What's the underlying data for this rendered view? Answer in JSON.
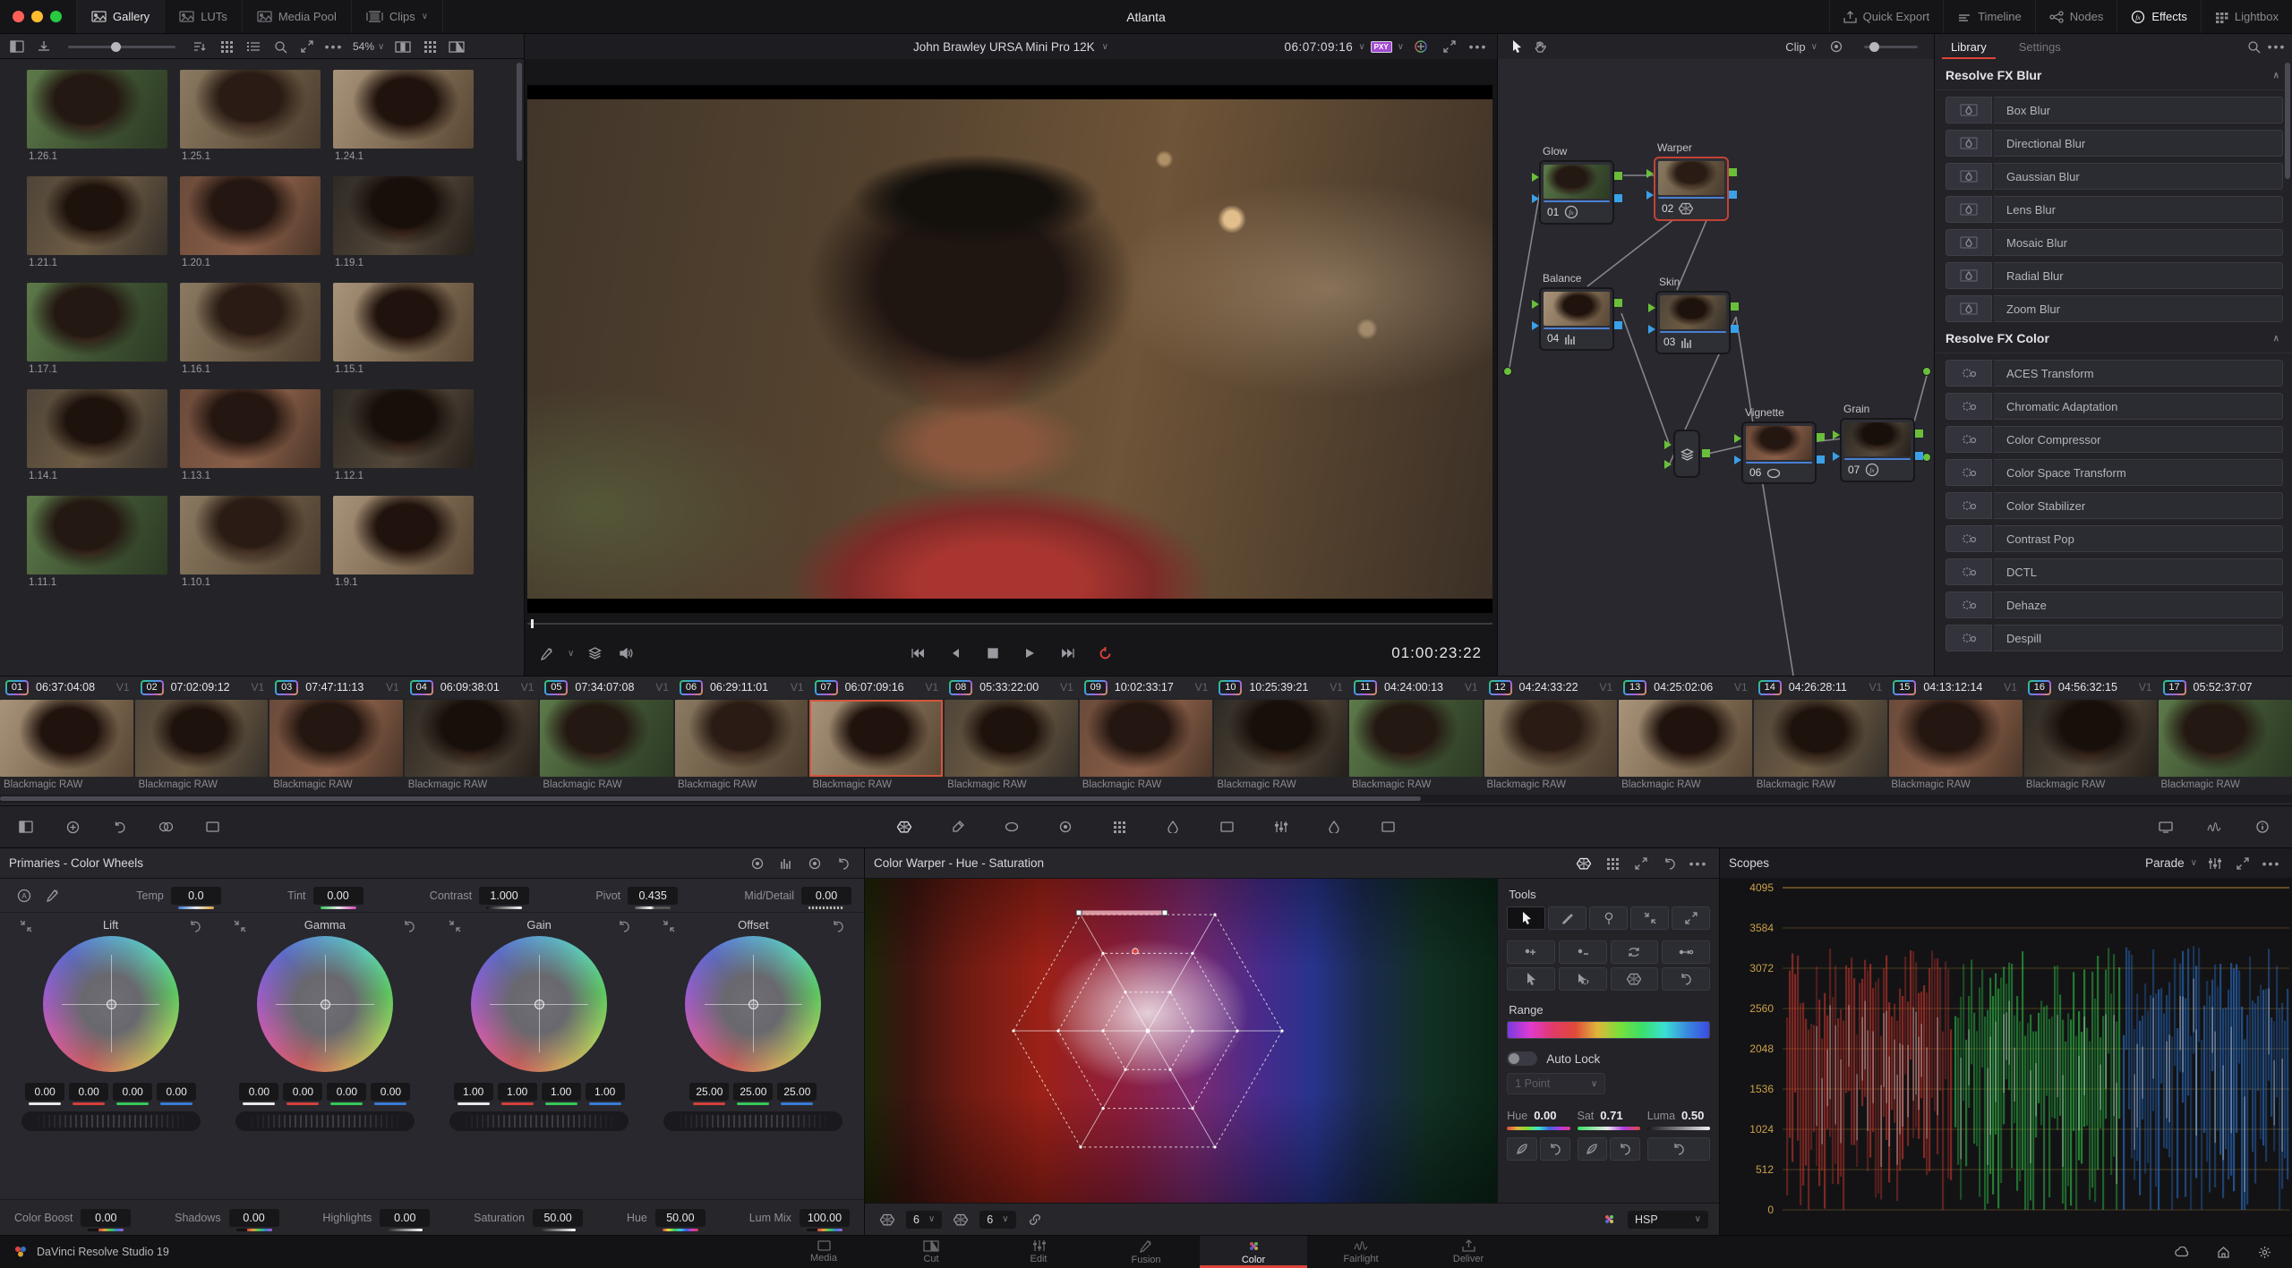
{
  "app": {
    "title": "Atlanta",
    "brand": "DaVinci Resolve Studio 19"
  },
  "topbar": {
    "left_tabs": [
      {
        "label": "Gallery",
        "icon": "gallery-icon",
        "active": true
      },
      {
        "label": "LUTs",
        "icon": "luts-icon",
        "active": false
      },
      {
        "label": "Media Pool",
        "icon": "media-pool-icon",
        "active": false
      },
      {
        "label": "Clips",
        "icon": "clips-icon",
        "active": false,
        "dropdown": true
      }
    ],
    "right_buttons": [
      {
        "label": "Quick Export",
        "icon": "export-icon",
        "active": false
      },
      {
        "label": "Timeline",
        "icon": "timeline-icon",
        "active": false
      },
      {
        "label": "Nodes",
        "icon": "nodes-icon",
        "active": false
      },
      {
        "label": "Effects",
        "icon": "effects-icon",
        "active": true
      },
      {
        "label": "Lightbox",
        "icon": "lightbox-icon",
        "active": false
      }
    ]
  },
  "gallery": {
    "zoom": "54%",
    "stills": [
      "1.26.1",
      "1.25.1",
      "1.24.1",
      "1.21.1",
      "1.20.1",
      "1.19.1",
      "1.17.1",
      "1.16.1",
      "1.15.1",
      "1.14.1",
      "1.13.1",
      "1.12.1",
      "1.11.1",
      "1.10.1",
      "1.9.1"
    ]
  },
  "viewer": {
    "clip_name": "John Brawley URSA Mini Pro 12K",
    "timecode": "06:07:09:16",
    "proxy_badge": "PXY",
    "duration_timecode": "01:00:23:22"
  },
  "nodes_panel": {
    "mode": "Clip",
    "nodes": [
      {
        "num": "01",
        "label": "Glow",
        "selected": false
      },
      {
        "num": "02",
        "label": "Warper",
        "selected": true
      },
      {
        "num": "04",
        "label": "Balance",
        "selected": false
      },
      {
        "num": "03",
        "label": "Skin",
        "selected": false
      },
      {
        "num": "06",
        "label": "Vignette",
        "selected": false
      },
      {
        "num": "07",
        "label": "Grain",
        "selected": false
      }
    ]
  },
  "library": {
    "tabs": [
      "Library",
      "Settings"
    ],
    "sections": [
      {
        "title": "Resolve FX Blur",
        "items": [
          "Box Blur",
          "Directional Blur",
          "Gaussian Blur",
          "Lens Blur",
          "Mosaic Blur",
          "Radial Blur",
          "Zoom Blur"
        ]
      },
      {
        "title": "Resolve FX Color",
        "items": [
          "ACES Transform",
          "Chromatic Adaptation",
          "Color Compressor",
          "Color Space Transform",
          "Color Stabilizer",
          "Contrast Pop",
          "DCTL",
          "Dehaze",
          "Despill"
        ]
      }
    ]
  },
  "timeline": {
    "track": "V1",
    "format_label": "Blackmagic RAW",
    "selected_num": "07",
    "clips": [
      {
        "num": "01",
        "tc": "06:37:04:08"
      },
      {
        "num": "02",
        "tc": "07:02:09:12"
      },
      {
        "num": "03",
        "tc": "07:47:11:13"
      },
      {
        "num": "04",
        "tc": "06:09:38:01"
      },
      {
        "num": "05",
        "tc": "07:34:07:08"
      },
      {
        "num": "06",
        "tc": "06:29:11:01"
      },
      {
        "num": "07",
        "tc": "06:07:09:16"
      },
      {
        "num": "08",
        "tc": "05:33:22:00"
      },
      {
        "num": "09",
        "tc": "10:02:33:17"
      },
      {
        "num": "10",
        "tc": "10:25:39:21"
      },
      {
        "num": "11",
        "tc": "04:24:00:13"
      },
      {
        "num": "12",
        "tc": "04:24:33:22"
      },
      {
        "num": "13",
        "tc": "04:25:02:06"
      },
      {
        "num": "14",
        "tc": "04:26:28:11"
      },
      {
        "num": "15",
        "tc": "04:13:12:14"
      },
      {
        "num": "16",
        "tc": "04:56:32:15"
      },
      {
        "num": "17",
        "tc": "05:52:37:07"
      }
    ]
  },
  "primaries": {
    "title": "Primaries - Color Wheels",
    "params": [
      {
        "label": "Temp",
        "value": "0.0"
      },
      {
        "label": "Tint",
        "value": "0.00"
      },
      {
        "label": "Contrast",
        "value": "1.000"
      },
      {
        "label": "Pivot",
        "value": "0.435"
      },
      {
        "label": "Mid/Detail",
        "value": "0.00"
      }
    ],
    "wheels": [
      {
        "label": "Lift",
        "values": [
          "0.00",
          "0.00",
          "0.00",
          "0.00"
        ]
      },
      {
        "label": "Gamma",
        "values": [
          "0.00",
          "0.00",
          "0.00",
          "0.00"
        ]
      },
      {
        "label": "Gain",
        "values": [
          "1.00",
          "1.00",
          "1.00",
          "1.00"
        ]
      },
      {
        "label": "Offset",
        "values": [
          "25.00",
          "25.00",
          "25.00"
        ]
      }
    ],
    "footer": [
      {
        "label": "Color Boost",
        "value": "0.00"
      },
      {
        "label": "Shadows",
        "value": "0.00"
      },
      {
        "label": "Highlights",
        "value": "0.00"
      },
      {
        "label": "Saturation",
        "value": "50.00"
      },
      {
        "label": "Hue",
        "value": "50.00"
      },
      {
        "label": "Lum Mix",
        "value": "100.00"
      }
    ]
  },
  "warper": {
    "title": "Color Warper - Hue - Saturation",
    "hue_steps": "6",
    "sat_steps": "6",
    "color_model": "HSP"
  },
  "warper_tools": {
    "title": "Tools",
    "range_label": "Range",
    "auto_lock_label": "Auto Lock",
    "point_mode": "1 Point",
    "hue_label": "Hue",
    "hue_value": "0.00",
    "sat_label": "Sat",
    "sat_value": "0.71",
    "luma_label": "Luma",
    "luma_value": "0.50"
  },
  "scopes": {
    "title": "Scopes",
    "mode": "Parade",
    "scale": [
      "4095",
      "3584",
      "3072",
      "2560",
      "2048",
      "1536",
      "1024",
      "512",
      "0"
    ]
  },
  "pages": {
    "items": [
      "Media",
      "Cut",
      "Edit",
      "Fusion",
      "Color",
      "Fairlight",
      "Deliver"
    ],
    "active": "Color"
  }
}
